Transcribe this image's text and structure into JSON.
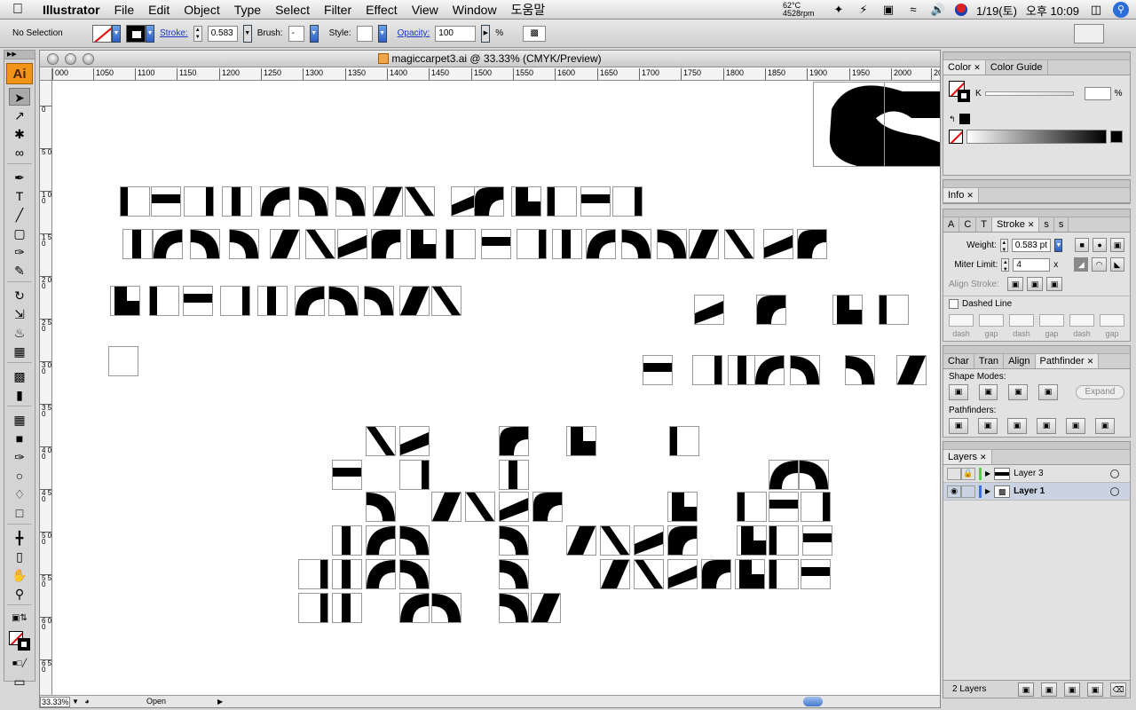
{
  "menubar": {
    "app": "Illustrator",
    "items": [
      "File",
      "Edit",
      "Object",
      "Type",
      "Select",
      "Filter",
      "Effect",
      "View",
      "Window",
      "도움말"
    ],
    "temp": "62°C",
    "rpm": "4528rpm",
    "date": "1/19(토)",
    "time": "오후 10:09"
  },
  "controlbar": {
    "selection": "No Selection",
    "stroke_label": "Stroke:",
    "stroke_value": "0.583",
    "brush_label": "Brush:",
    "brush_value": "-",
    "style_label": "Style:",
    "opacity_label": "Opacity:",
    "opacity_value": "100",
    "percent": "%"
  },
  "tools": {
    "logo": "Ai",
    "items": [
      "selection-icon",
      "direct-selection-icon",
      "magic-wand-icon",
      "lasso-icon",
      "pen-icon",
      "type-icon",
      "line-icon",
      "rectangle-icon",
      "paintbrush-icon",
      "pencil-icon",
      "rotate-icon",
      "scale-icon",
      "warp-icon",
      "free-transform-icon",
      "symbol-sprayer-icon",
      "column-graph-icon",
      "mesh-icon",
      "gradient-icon",
      "eyedropper-icon",
      "blend-icon",
      "live-paint-icon",
      "live-paint-selection-icon",
      "slice-icon",
      "eraser-icon",
      "hand-icon",
      "zoom-icon"
    ]
  },
  "document": {
    "title": "magiccarpet3.ai @ 33.33% (CMYK/Preview)",
    "ruler_ticks": [
      "000",
      "1050",
      "1100",
      "1150",
      "1200",
      "1250",
      "1300",
      "1350",
      "1400",
      "1450",
      "1500",
      "1550",
      "1600",
      "1650",
      "1700",
      "1750",
      "1800",
      "1850",
      "1900",
      "1950",
      "2000",
      "20"
    ],
    "vruler_ticks": [
      "0",
      "5 0",
      "1 0 0",
      "1 5 0",
      "2 0 0",
      "2 5 0",
      "3 0 0",
      "3 5 0",
      "4 0 0",
      "4 5 0",
      "5 0 0",
      "5 5 0",
      "6 0 0",
      "6 5 0"
    ],
    "zoom": "33.33%",
    "status": "Open"
  },
  "panels": {
    "color": {
      "tabs": [
        "Color",
        "Color Guide"
      ],
      "channel": "K",
      "percent": "%"
    },
    "info": {
      "tabs": [
        "Info"
      ]
    },
    "stroke": {
      "tabs": [
        "A",
        "C",
        "T",
        "Stroke",
        "s",
        "s"
      ],
      "weight_label": "Weight:",
      "weight_value": "0.583 pt",
      "miter_label": "Miter Limit:",
      "miter_value": "4",
      "miter_unit": "x",
      "align_label": "Align Stroke:",
      "dashed_label": "Dashed Line",
      "dash_labels": [
        "dash",
        "gap",
        "dash",
        "gap",
        "dash",
        "gap"
      ]
    },
    "pathfinder": {
      "tabs": [
        "Char",
        "Tran",
        "Align",
        "Pathfinder"
      ],
      "shape_modes": "Shape Modes:",
      "expand": "Expand",
      "pathfinders": "Pathfinders:"
    },
    "layers": {
      "tabs": [
        "Layers"
      ],
      "rows": [
        "Layer 3",
        "Layer 1"
      ],
      "count": "2 Layers"
    }
  }
}
